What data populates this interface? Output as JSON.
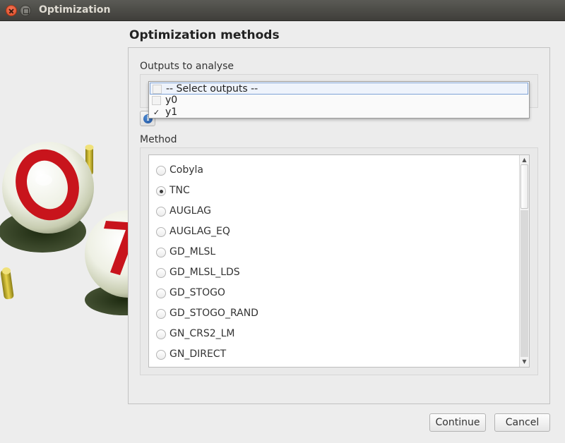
{
  "window": {
    "title": "Optimization"
  },
  "page": {
    "title": "Optimization methods"
  },
  "outputs": {
    "label": "Outputs to analyse",
    "dropdown_items": [
      {
        "label": "-- Select outputs --",
        "checked": false,
        "highlighted": true
      },
      {
        "label": "y0",
        "checked": false,
        "highlighted": false
      },
      {
        "label": "y1",
        "checked": true,
        "highlighted": false
      }
    ]
  },
  "method": {
    "label": "Method",
    "selected": "TNC",
    "options": [
      "Cobyla",
      "TNC",
      "AUGLAG",
      "AUGLAG_EQ",
      "GD_MLSL",
      "GD_MLSL_LDS",
      "GD_STOGO",
      "GD_STOGO_RAND",
      "GN_CRS2_LM",
      "GN_DIRECT"
    ]
  },
  "buttons": {
    "continue": "Continue",
    "cancel": "Cancel"
  },
  "icons": {
    "info": "info-icon",
    "close": "close-icon",
    "maximize": "maximize-icon",
    "check": "✓"
  },
  "colors": {
    "titlebar": "#3f3e3a",
    "close_button": "#df4b24",
    "logo_red": "#c8141c",
    "highlight_border": "#7fa3d6"
  }
}
